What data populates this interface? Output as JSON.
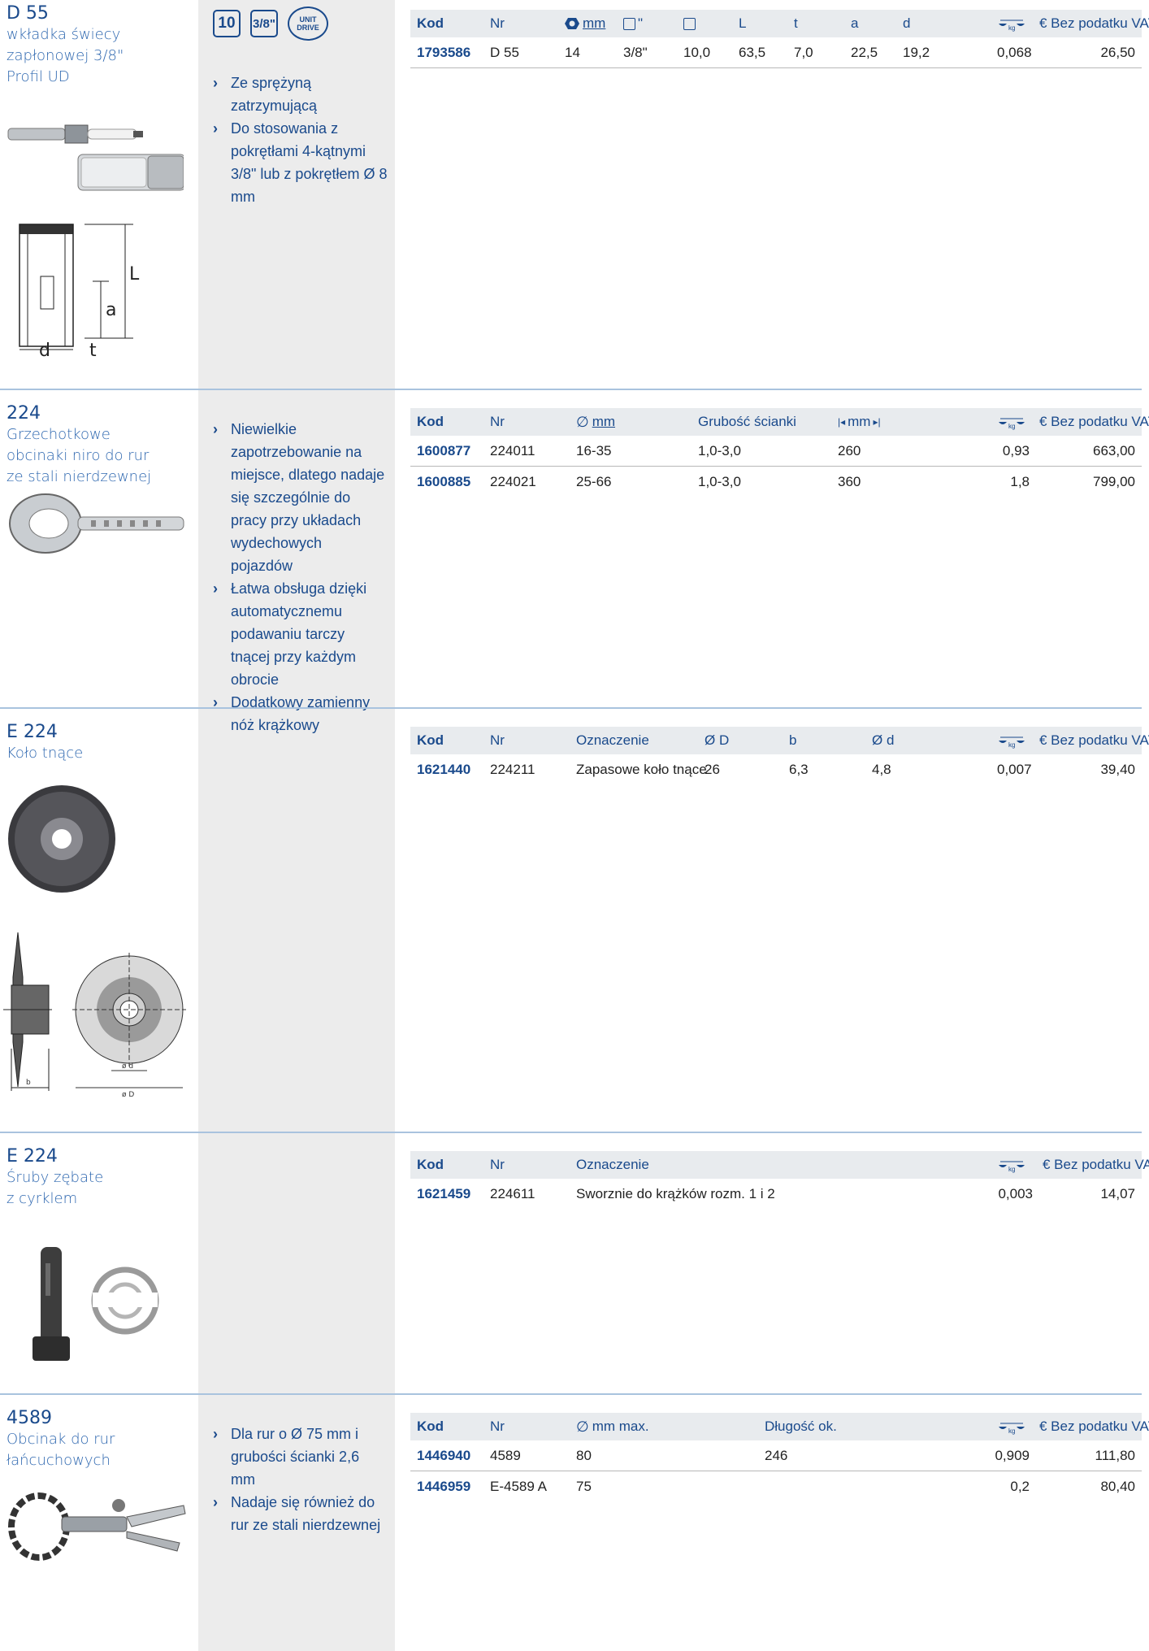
{
  "colors": {
    "accent": "#1a4a8c",
    "gray_column": "#ececec",
    "divider": "#a9c3de",
    "table_header": "#e8ebee"
  },
  "sections": [
    {
      "nr": "D 55",
      "title": [
        "wkładka świecy",
        "zapłonowej 3/8\"",
        "Profil UD"
      ],
      "badges": {
        "size": "10",
        "drive": "3/8\"",
        "unit_line1": "UNIT",
        "unit_line2": "DRIVE"
      },
      "features": [
        "Ze sprężyną zatrzymującą",
        "Do stosowania z pokrętłami 4-kątnymi 3/8\" lub z pokrętłem Ø 8 mm"
      ],
      "headers": [
        "Kod",
        "Nr",
        "mm",
        "\"",
        "",
        "L",
        "t",
        "a",
        "d",
        "kg",
        "€ Bez podatku VAT"
      ],
      "rows": [
        [
          "1793586",
          "D 55",
          "14",
          "3/8\"",
          "10,0",
          "63,5",
          "7,0",
          "22,5",
          "19,2",
          "0,068",
          "26,50"
        ]
      ],
      "drawing_labels": [
        "L",
        "a",
        "d",
        "t"
      ]
    },
    {
      "nr": "224",
      "title": [
        "Grzechotkowe",
        "obcinaki niro do rur",
        "ze stali nierdzewnej"
      ],
      "features": [
        "Niewielkie zapotrzebowanie na miejsce, dlatego nadaje się szczególnie do pracy przy układach wydechowych pojazdów",
        "Łatwa obsługa dzięki automatycznemu podawaniu tarczy tnącej przy każdym obrocie",
        "Dodatkowy zamienny nóż krążkowy"
      ],
      "headers": [
        "Kod",
        "Nr",
        "mm",
        "Grubość ścianki",
        "mm",
        "kg",
        "€ Bez podatku VAT"
      ],
      "rows": [
        [
          "1600877",
          "224011",
          "16-35",
          "1,0-3,0",
          "260",
          "0,93",
          "663,00"
        ],
        [
          "1600885",
          "224021",
          "25-66",
          "1,0-3,0",
          "360",
          "1,8",
          "799,00"
        ]
      ]
    },
    {
      "nr": "E 224",
      "title": [
        "Koło tnące"
      ],
      "features": [],
      "headers": [
        "Kod",
        "Nr",
        "Oznaczenie",
        "Ø D",
        "b",
        "Ø d",
        "kg",
        "€ Bez podatku VAT"
      ],
      "rows": [
        [
          "1621440",
          "224211",
          "Zapasowe koło tnące",
          "26",
          "6,3",
          "4,8",
          "0,007",
          "39,40"
        ]
      ],
      "drawing_labels": [
        "b",
        "ø d",
        "ø D"
      ]
    },
    {
      "nr": "E 224",
      "title": [
        "Śruby zębate",
        "z cyrklem"
      ],
      "features": [],
      "headers": [
        "Kod",
        "Nr",
        "Oznaczenie",
        "kg",
        "€ Bez podatku VAT"
      ],
      "rows": [
        [
          "1621459",
          "224611",
          "Sworznie do krążków rozm. 1 i 2",
          "0,003",
          "14,07"
        ]
      ]
    },
    {
      "nr": "4589",
      "title": [
        "Obcinak do rur",
        "łańcuchowych"
      ],
      "features": [
        "Dla rur o Ø 75 mm i grubości ścianki 2,6 mm",
        "Nadaje się również do rur ze stali nierdzewnej"
      ],
      "headers": [
        "Kod",
        "Nr",
        "mm max.",
        "Długość ok.",
        "kg",
        "€ Bez podatku VAT"
      ],
      "rows": [
        [
          "1446940",
          "4589",
          "80",
          "246",
          "0,909",
          "111,80"
        ],
        [
          "1446959",
          "E-4589 A",
          "75",
          "",
          "0,2",
          "80,40"
        ]
      ]
    }
  ]
}
